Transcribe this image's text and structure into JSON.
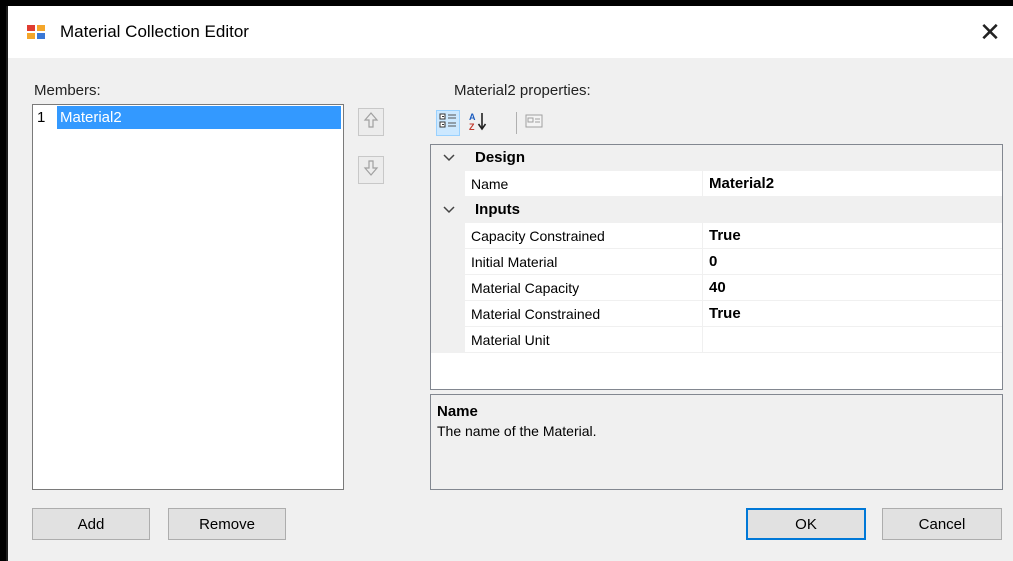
{
  "window": {
    "title": "Material Collection Editor",
    "close_glyph": "✕"
  },
  "members": {
    "label": "Members:",
    "items": [
      {
        "index": "1",
        "name": "Material2",
        "selected": true
      }
    ]
  },
  "properties": {
    "label": "Material2 properties:",
    "categories": [
      {
        "name": "Design",
        "rows": [
          {
            "name": "Name",
            "value": "Material2"
          }
        ]
      },
      {
        "name": "Inputs",
        "rows": [
          {
            "name": "Capacity Constrained",
            "value": "True"
          },
          {
            "name": "Initial Material",
            "value": "0"
          },
          {
            "name": "Material Capacity",
            "value": "40"
          },
          {
            "name": "Material Constrained",
            "value": "True"
          },
          {
            "name": "Material Unit",
            "value": ""
          }
        ]
      }
    ],
    "description": {
      "title": "Name",
      "text": "The name of the Material."
    }
  },
  "buttons": {
    "add": "Add",
    "remove": "Remove",
    "ok": "OK",
    "cancel": "Cancel"
  },
  "colors": {
    "selection": "#3399ff",
    "ok_border": "#0078d7"
  }
}
